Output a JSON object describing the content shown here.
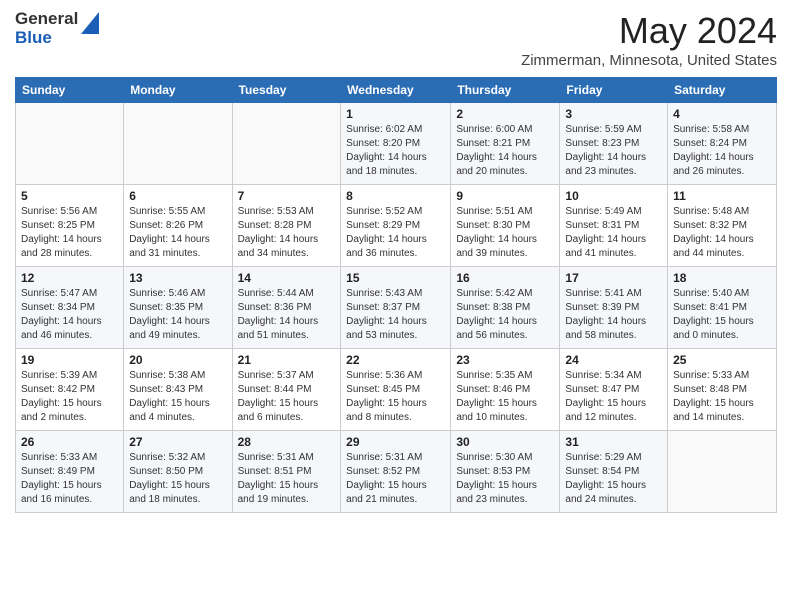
{
  "logo": {
    "line1": "General",
    "line2": "Blue"
  },
  "title": "May 2024",
  "location": "Zimmerman, Minnesota, United States",
  "days_of_week": [
    "Sunday",
    "Monday",
    "Tuesday",
    "Wednesday",
    "Thursday",
    "Friday",
    "Saturday"
  ],
  "weeks": [
    [
      {
        "day": "",
        "info": ""
      },
      {
        "day": "",
        "info": ""
      },
      {
        "day": "",
        "info": ""
      },
      {
        "day": "1",
        "info": "Sunrise: 6:02 AM\nSunset: 8:20 PM\nDaylight: 14 hours\nand 18 minutes."
      },
      {
        "day": "2",
        "info": "Sunrise: 6:00 AM\nSunset: 8:21 PM\nDaylight: 14 hours\nand 20 minutes."
      },
      {
        "day": "3",
        "info": "Sunrise: 5:59 AM\nSunset: 8:23 PM\nDaylight: 14 hours\nand 23 minutes."
      },
      {
        "day": "4",
        "info": "Sunrise: 5:58 AM\nSunset: 8:24 PM\nDaylight: 14 hours\nand 26 minutes."
      }
    ],
    [
      {
        "day": "5",
        "info": "Sunrise: 5:56 AM\nSunset: 8:25 PM\nDaylight: 14 hours\nand 28 minutes."
      },
      {
        "day": "6",
        "info": "Sunrise: 5:55 AM\nSunset: 8:26 PM\nDaylight: 14 hours\nand 31 minutes."
      },
      {
        "day": "7",
        "info": "Sunrise: 5:53 AM\nSunset: 8:28 PM\nDaylight: 14 hours\nand 34 minutes."
      },
      {
        "day": "8",
        "info": "Sunrise: 5:52 AM\nSunset: 8:29 PM\nDaylight: 14 hours\nand 36 minutes."
      },
      {
        "day": "9",
        "info": "Sunrise: 5:51 AM\nSunset: 8:30 PM\nDaylight: 14 hours\nand 39 minutes."
      },
      {
        "day": "10",
        "info": "Sunrise: 5:49 AM\nSunset: 8:31 PM\nDaylight: 14 hours\nand 41 minutes."
      },
      {
        "day": "11",
        "info": "Sunrise: 5:48 AM\nSunset: 8:32 PM\nDaylight: 14 hours\nand 44 minutes."
      }
    ],
    [
      {
        "day": "12",
        "info": "Sunrise: 5:47 AM\nSunset: 8:34 PM\nDaylight: 14 hours\nand 46 minutes."
      },
      {
        "day": "13",
        "info": "Sunrise: 5:46 AM\nSunset: 8:35 PM\nDaylight: 14 hours\nand 49 minutes."
      },
      {
        "day": "14",
        "info": "Sunrise: 5:44 AM\nSunset: 8:36 PM\nDaylight: 14 hours\nand 51 minutes."
      },
      {
        "day": "15",
        "info": "Sunrise: 5:43 AM\nSunset: 8:37 PM\nDaylight: 14 hours\nand 53 minutes."
      },
      {
        "day": "16",
        "info": "Sunrise: 5:42 AM\nSunset: 8:38 PM\nDaylight: 14 hours\nand 56 minutes."
      },
      {
        "day": "17",
        "info": "Sunrise: 5:41 AM\nSunset: 8:39 PM\nDaylight: 14 hours\nand 58 minutes."
      },
      {
        "day": "18",
        "info": "Sunrise: 5:40 AM\nSunset: 8:41 PM\nDaylight: 15 hours\nand 0 minutes."
      }
    ],
    [
      {
        "day": "19",
        "info": "Sunrise: 5:39 AM\nSunset: 8:42 PM\nDaylight: 15 hours\nand 2 minutes."
      },
      {
        "day": "20",
        "info": "Sunrise: 5:38 AM\nSunset: 8:43 PM\nDaylight: 15 hours\nand 4 minutes."
      },
      {
        "day": "21",
        "info": "Sunrise: 5:37 AM\nSunset: 8:44 PM\nDaylight: 15 hours\nand 6 minutes."
      },
      {
        "day": "22",
        "info": "Sunrise: 5:36 AM\nSunset: 8:45 PM\nDaylight: 15 hours\nand 8 minutes."
      },
      {
        "day": "23",
        "info": "Sunrise: 5:35 AM\nSunset: 8:46 PM\nDaylight: 15 hours\nand 10 minutes."
      },
      {
        "day": "24",
        "info": "Sunrise: 5:34 AM\nSunset: 8:47 PM\nDaylight: 15 hours\nand 12 minutes."
      },
      {
        "day": "25",
        "info": "Sunrise: 5:33 AM\nSunset: 8:48 PM\nDaylight: 15 hours\nand 14 minutes."
      }
    ],
    [
      {
        "day": "26",
        "info": "Sunrise: 5:33 AM\nSunset: 8:49 PM\nDaylight: 15 hours\nand 16 minutes."
      },
      {
        "day": "27",
        "info": "Sunrise: 5:32 AM\nSunset: 8:50 PM\nDaylight: 15 hours\nand 18 minutes."
      },
      {
        "day": "28",
        "info": "Sunrise: 5:31 AM\nSunset: 8:51 PM\nDaylight: 15 hours\nand 19 minutes."
      },
      {
        "day": "29",
        "info": "Sunrise: 5:31 AM\nSunset: 8:52 PM\nDaylight: 15 hours\nand 21 minutes."
      },
      {
        "day": "30",
        "info": "Sunrise: 5:30 AM\nSunset: 8:53 PM\nDaylight: 15 hours\nand 23 minutes."
      },
      {
        "day": "31",
        "info": "Sunrise: 5:29 AM\nSunset: 8:54 PM\nDaylight: 15 hours\nand 24 minutes."
      },
      {
        "day": "",
        "info": ""
      }
    ]
  ]
}
